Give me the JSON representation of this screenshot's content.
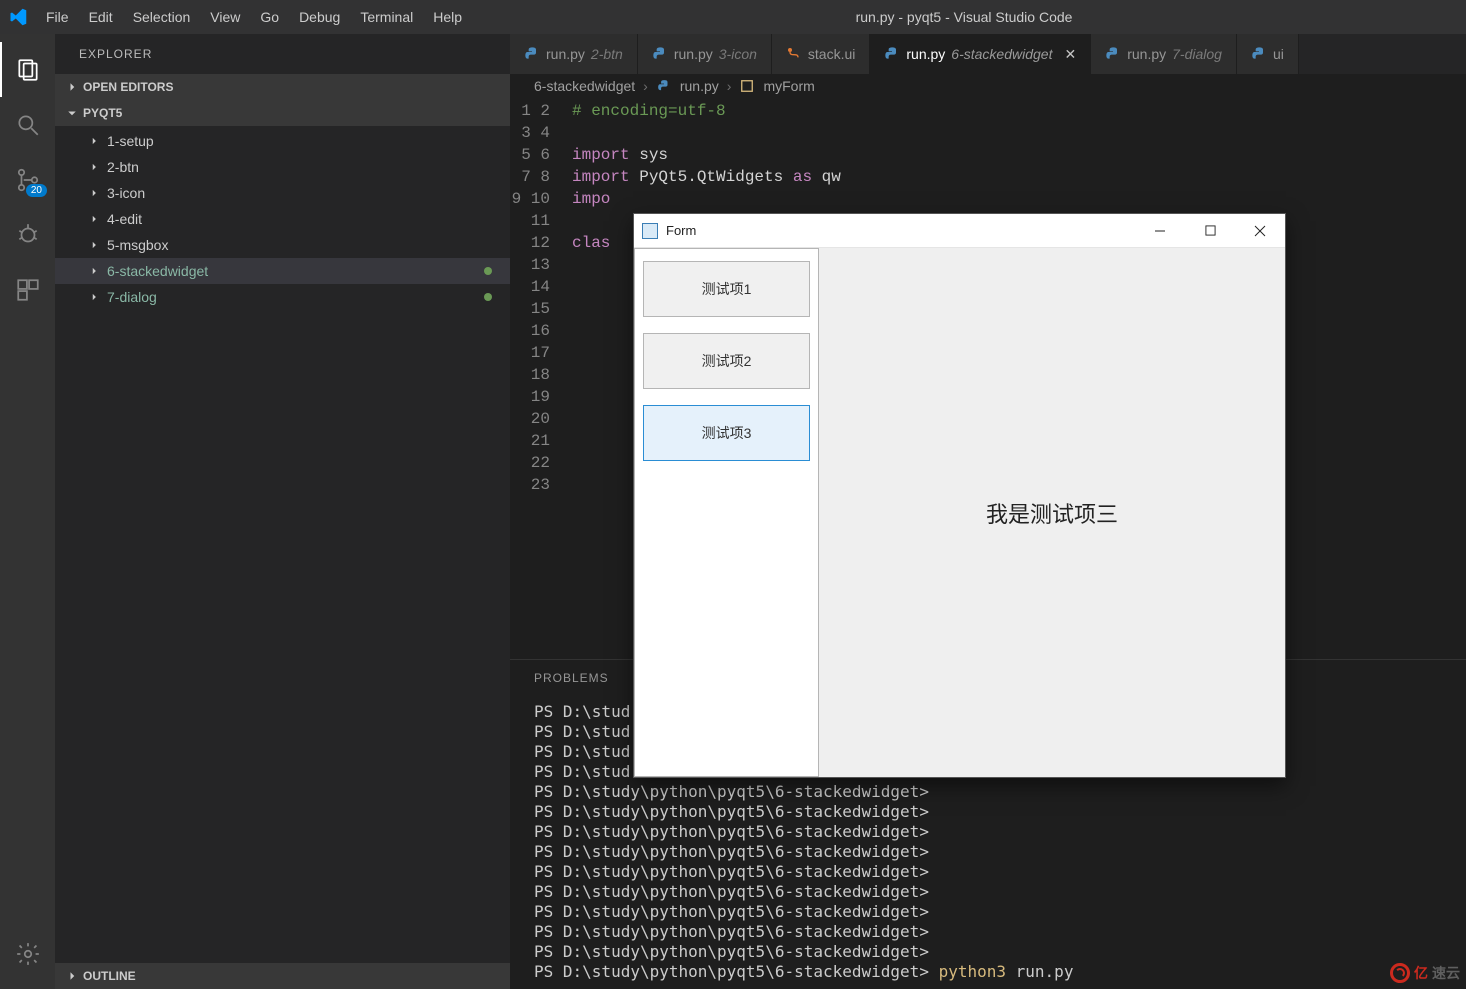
{
  "window": {
    "title": "run.py - pyqt5 - Visual Studio Code"
  },
  "menu": [
    "File",
    "Edit",
    "Selection",
    "View",
    "Go",
    "Debug",
    "Terminal",
    "Help"
  ],
  "activity": {
    "badge": "20"
  },
  "sidebar": {
    "title": "EXPLORER",
    "sections": {
      "open_editors": "OPEN EDITORS",
      "project": "PYQT5"
    },
    "tree": [
      {
        "label": "1-setup",
        "active": false,
        "dot": false
      },
      {
        "label": "2-btn",
        "active": false,
        "dot": false
      },
      {
        "label": "3-icon",
        "active": false,
        "dot": false
      },
      {
        "label": "4-edit",
        "active": false,
        "dot": false
      },
      {
        "label": "5-msgbox",
        "active": false,
        "dot": false
      },
      {
        "label": "6-stackedwidget",
        "active": true,
        "dot": true
      },
      {
        "label": "7-dialog",
        "active": false,
        "dot": true,
        "dim": true
      }
    ],
    "outline": "OUTLINE"
  },
  "tabs": [
    {
      "name": "run.py",
      "desc": "2-btn",
      "icon": "python",
      "active": false,
      "close": false
    },
    {
      "name": "run.py",
      "desc": "3-icon",
      "icon": "python",
      "active": false,
      "close": false
    },
    {
      "name": "stack.ui",
      "desc": "",
      "icon": "xml",
      "active": false,
      "close": false
    },
    {
      "name": "run.py",
      "desc": "6-stackedwidget",
      "icon": "python",
      "active": true,
      "close": true
    },
    {
      "name": "run.py",
      "desc": "7-dialog",
      "icon": "python",
      "active": false,
      "close": false
    },
    {
      "name": "ui",
      "desc": "",
      "icon": "python",
      "active": false,
      "close": false
    }
  ],
  "breadcrumb": {
    "seg1": "6-stackedwidget",
    "seg2": "run.py",
    "seg3": "myForm"
  },
  "code": {
    "line_count": 23,
    "lines": {
      "l1": "# encoding=utf-8",
      "l3_kw": "import",
      "l3_rest": " sys",
      "l4_kw1": "import",
      "l4_mid": " PyQt5.QtWidgets ",
      "l4_kw2": "as",
      "l4_rest": " qw",
      "l5_kw": "impo",
      "l7_kw": "clas"
    }
  },
  "panel": {
    "problems": "PROBLEMS"
  },
  "terminal": {
    "prompt_prefix": "PS ",
    "path": "D:\\study\\python\\pyqt5\\6-stackedwidget>",
    "short": "D:\\stud",
    "cmd": "python3",
    "cmd_arg": " run.py",
    "repeat1": 4,
    "repeat2": 9
  },
  "form": {
    "title": "Form",
    "items": [
      "测试项1",
      "测试项2",
      "测试项3"
    ],
    "selected_index": 2,
    "content": "我是测试项三"
  },
  "watermark": {
    "red": "亿",
    "rest": "速云"
  }
}
